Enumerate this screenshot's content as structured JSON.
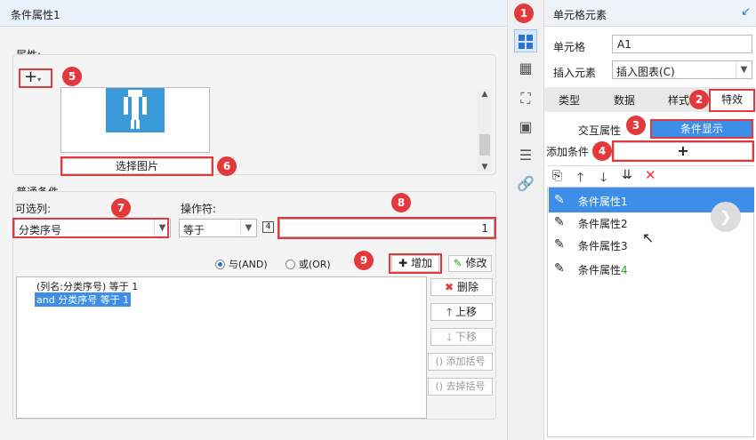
{
  "dialog": {
    "title": "条件属性1"
  },
  "attributes": {
    "section_label": "属性:",
    "add_symbol": "+",
    "select_image_label": "选择图片"
  },
  "common": {
    "section_label": "普通条件",
    "optional_label": "可选列:",
    "optional_value": "分类序号",
    "operator_label": "操作符:",
    "operator_value": "等于",
    "value_type_icon": "4",
    "value": "1",
    "and_label": "与(AND)",
    "or_label": "或(OR)",
    "add_label": "增加",
    "modify_label": "修改",
    "conditions": [
      {
        "text": "(列名:分类序号) 等于 1"
      },
      {
        "text": "and 分类序号 等于 1"
      }
    ],
    "delete_label": "删除",
    "up_label": "上移",
    "down_label": "下移",
    "add_bracket_label": "添加括号",
    "remove_bracket_label": "去掉括号"
  },
  "right": {
    "title": "单元格元素",
    "cell_label": "单元格",
    "cell_value": "A1",
    "insert_label": "插入元素",
    "insert_value": "插入图表(C)",
    "tabs": [
      "类型",
      "数据",
      "样式",
      "特效"
    ],
    "interact_label": "交互属性",
    "condition_display_label": "条件显示",
    "add_condition_label": "添加条件",
    "add_condition_symbol": "+",
    "items": [
      {
        "name": "条件属性",
        "num": "1"
      },
      {
        "name": "条件属性",
        "num": "2"
      },
      {
        "name": "条件属性",
        "num": "3"
      },
      {
        "name": "条件属性",
        "num": "4"
      }
    ]
  },
  "badges": [
    "1",
    "2",
    "3",
    "4",
    "5",
    "6",
    "7",
    "8",
    "9"
  ],
  "colors": {
    "red": "#e4393c",
    "blue": "#2a74d6",
    "selected": "#3d8ee9",
    "green_num": "#2e9a2e"
  }
}
